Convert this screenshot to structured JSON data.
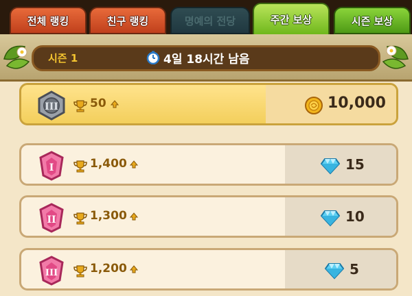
{
  "tabs": [
    {
      "label": "전체 랭킹",
      "state": "inactive"
    },
    {
      "label": "친구 랭킹",
      "state": "inactive"
    },
    {
      "label": "명예의 전당",
      "state": "disabled"
    },
    {
      "label": "주간 보상",
      "state": "active"
    },
    {
      "label": "시즌 보상",
      "state": "inactive"
    }
  ],
  "season": {
    "label": "시즌 1",
    "time_remaining": "4일 18시간 남음"
  },
  "rewards": [
    {
      "tier_icon": "silver-tier-badge-icon",
      "tier_roman": "III",
      "trophy_requirement": "50",
      "reward_icon": "gold-coin-icon",
      "reward_value": "10,000"
    },
    {
      "tier_icon": "pink-tier-badge-icon",
      "tier_roman": "I",
      "trophy_requirement": "1,400",
      "reward_icon": "diamond-icon",
      "reward_value": "15"
    },
    {
      "tier_icon": "pink-tier-badge-icon",
      "tier_roman": "II",
      "trophy_requirement": "1,300",
      "reward_icon": "diamond-icon",
      "reward_value": "10"
    },
    {
      "tier_icon": "pink-tier-badge-icon",
      "tier_roman": "III",
      "trophy_requirement": "1,200",
      "reward_icon": "diamond-icon",
      "reward_value": "5"
    }
  ],
  "colors": {
    "active_tab": "#8ad43a",
    "inactive_tab": "#d8582a",
    "highlight_row": "#ffe38c",
    "season_label": "#f4c430"
  }
}
